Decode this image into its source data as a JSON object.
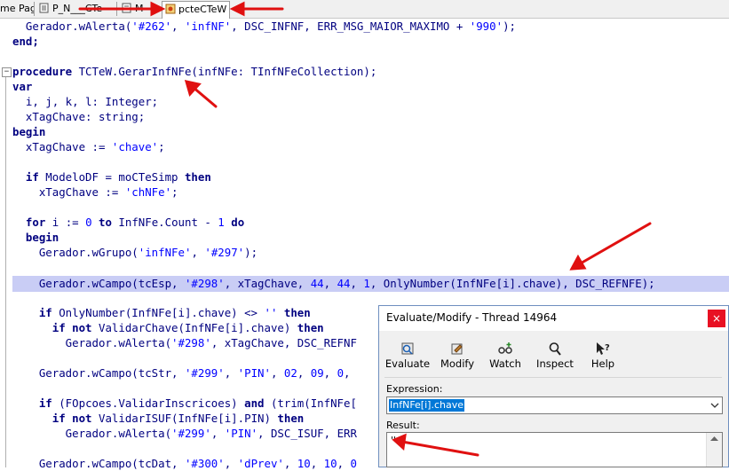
{
  "tabs": [
    {
      "label": "me Page",
      "active": false
    },
    {
      "label": "P_N___CTe",
      "active": false
    },
    {
      "label": "M",
      "active": false
    },
    {
      "label": "pcteCTeW",
      "active": true
    }
  ],
  "code": {
    "l01": "  Gerador.wAlerta(",
    "l01s": "'#262'",
    "l01b": ", ",
    "l01c": "'infNF'",
    "l01d": ", DSC_INFNF, ERR_MSG_MAIOR_MAXIMO + ",
    "l01e": "'990'",
    "l01f": ");",
    "l02": "end;",
    "l03k": "procedure",
    "l03": " TCTeW.GerarInfNFe(infNFe: TInfNFeCollection);",
    "l04": "var",
    "l05": "  i, j, k, l: Integer;",
    "l06": "  xTagChave: string;",
    "l07": "begin",
    "l08": "  xTagChave := ",
    "l08s": "'chave'",
    "l08e": ";",
    "l09k": "  if",
    "l09": " ModeloDF = moCTeSimp ",
    "l09k2": "then",
    "l10": "    xTagChave := ",
    "l10s": "'chNFe'",
    "l10e": ";",
    "l11k": "  for",
    "l11": " i := ",
    "l11n": "0",
    "l11b": " ",
    "l11k2": "to",
    "l11c": " InfNFe.Count - ",
    "l11n2": "1",
    "l11d": " ",
    "l11k3": "do",
    "l12": "  begin",
    "l13": "    Gerador.wGrupo(",
    "l13s": "'infNFe'",
    "l13b": ", ",
    "l13c": "'#297'",
    "l13e": ");",
    "l14": "    Gerador.wCampo(tcEsp, ",
    "l14s": "'#298'",
    "l14b": ", xTagChave, ",
    "l14n": "44",
    "l14c": ", ",
    "l14n2": "44",
    "l14d": ", ",
    "l14n3": "1",
    "l14e": ", OnlyNumber(InfNFe[i].chave), DSC_REFNFE);",
    "l15k": "    if",
    "l15": " OnlyNumber(InfNFe[i].chave) <> ",
    "l15s": "''",
    "l15b": " ",
    "l15k2": "then",
    "l16k": "      if not",
    "l16": " ValidarChave(InfNFe[i].chave) ",
    "l16k2": "then",
    "l17": "        Gerador.wAlerta(",
    "l17s": "'#298'",
    "l17b": ", xTagChave, DSC_REFNF",
    "l18": "    Gerador.wCampo(tcStr, ",
    "l18s": "'#299'",
    "l18b": ", ",
    "l18c": "'PIN'",
    "l18d": ", ",
    "l18n": "02",
    "l18e": ", ",
    "l18n2": "09",
    "l18f": ", ",
    "l18n3": "0",
    "l18g": ",",
    "l19k": "    if",
    "l19": " (FOpcoes.ValidarInscricoes) ",
    "l19k2": "and",
    "l19b": " (trim(InfNFe[",
    "l20k": "      if not",
    "l20": " ValidarISUF(InfNFe[i].PIN) ",
    "l20k2": "then",
    "l21": "        Gerador.wAlerta(",
    "l21s": "'#299'",
    "l21b": ", ",
    "l21c": "'PIN'",
    "l21d": ", DSC_ISUF, ERR",
    "l22": "    Gerador.wCampo(tcDat, ",
    "l22s": "'#300'",
    "l22b": ", ",
    "l22c": "'dPrev'",
    "l22d": ", ",
    "l22n": "10",
    "l22e": ", ",
    "l22n2": "10",
    "l22f": ", ",
    "l22n3": "0"
  },
  "dialog": {
    "title": "Evaluate/Modify - Thread 14964",
    "close": "×",
    "buttons": [
      {
        "label": "Evaluate",
        "icon": "evaluate-icon"
      },
      {
        "label": "Modify",
        "icon": "modify-icon"
      },
      {
        "label": "Watch",
        "icon": "watch-icon"
      },
      {
        "label": "Inspect",
        "icon": "inspect-icon"
      },
      {
        "label": "Help",
        "icon": "help-icon"
      }
    ],
    "expression_label": "Expression:",
    "expression_value": "InfNFe[i].chave",
    "result_label": "Result:",
    "result_value": "''"
  },
  "annotation_color": "#e01010",
  "highlight_color": "#c9cdf5"
}
